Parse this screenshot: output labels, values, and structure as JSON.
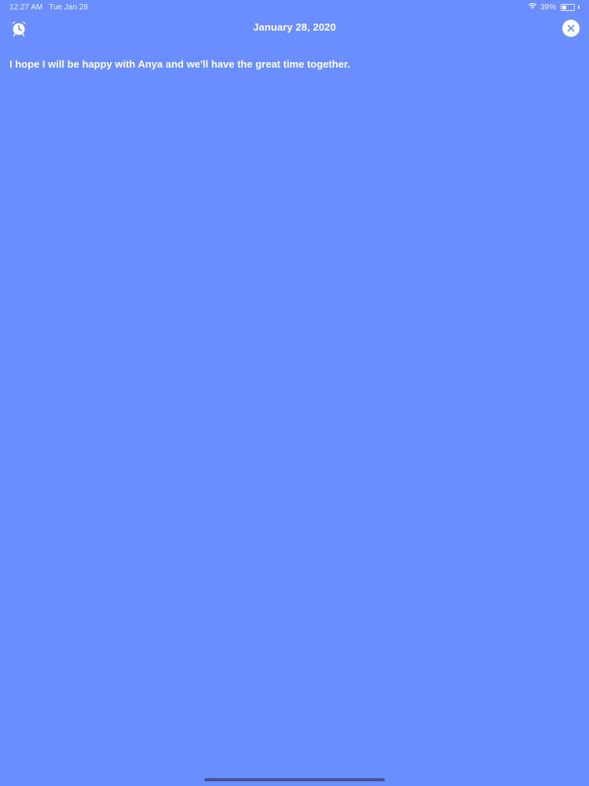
{
  "status_bar": {
    "time": "12:27 AM",
    "date": "Tue Jan 28",
    "battery_percent": "39%",
    "battery_level": 0.39,
    "wifi_icon": "wifi-icon",
    "battery_icon": "battery-icon"
  },
  "header": {
    "title": "January 28, 2020",
    "alarm_icon": "alarm-clock-icon",
    "close_icon": "close-icon"
  },
  "entry": {
    "text": "I hope I will be happy with Anya and we'll have the great time together."
  },
  "colors": {
    "background": "#6a8dff",
    "text": "#ffffff"
  }
}
